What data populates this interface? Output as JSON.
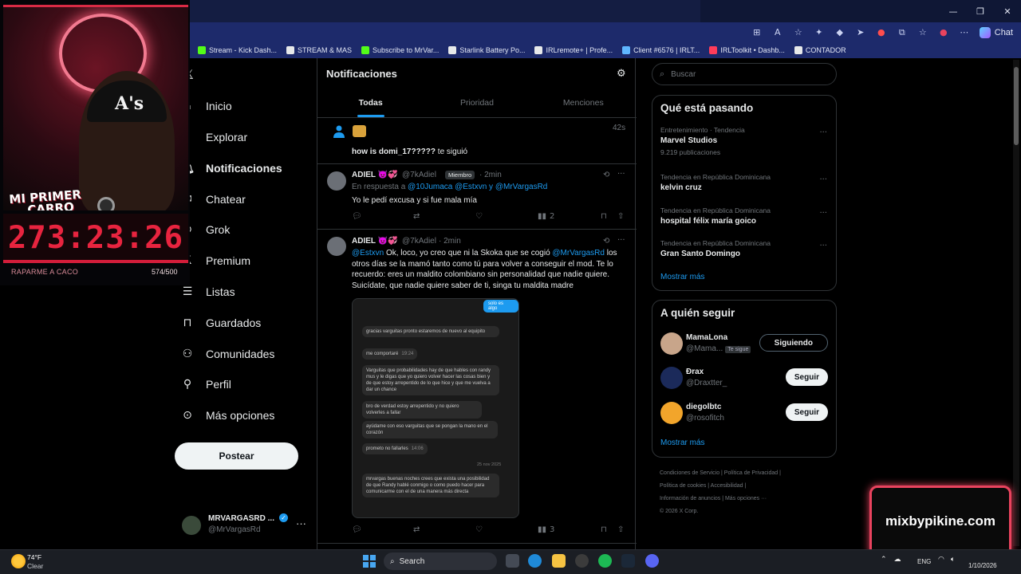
{
  "browser": {
    "chat_label": "Chat",
    "bookmarks": [
      {
        "label": "Stream - Kick Dash...",
        "color": "#53fc18"
      },
      {
        "label": "STREAM & MAS",
        "color": "#e7e9ea"
      },
      {
        "label": "Subscribe to MrVar...",
        "color": "#53fc18"
      },
      {
        "label": "Starlink Battery Po...",
        "color": "#e7e9ea"
      },
      {
        "label": "IRLremote+ | Profe...",
        "color": "#e7e9ea"
      },
      {
        "label": "Client #6576 | IRLT...",
        "color": "#5fb6ff"
      },
      {
        "label": "IRLToolkit • Dashb...",
        "color": "#ff3c5a"
      },
      {
        "label": "CONTADOR",
        "color": "#e7e9ea"
      }
    ]
  },
  "overlay": {
    "hat_text": "A's",
    "badge_line1": "MI PRIMER",
    "badge_line2": "CARRO",
    "timer": "273:23:26",
    "goal_label": "RAPARME A CACO",
    "goal_count": "574/500"
  },
  "nav": {
    "items": [
      {
        "label": "Inicio",
        "icon": "home-icon"
      },
      {
        "label": "Explorar",
        "icon": "search-icon"
      },
      {
        "label": "Notificaciones",
        "icon": "bell-icon"
      },
      {
        "label": "Chatear",
        "icon": "mail-icon"
      },
      {
        "label": "Grok",
        "icon": "grok-icon"
      },
      {
        "label": "Premium",
        "icon": "x-logo-icon"
      },
      {
        "label": "Listas",
        "icon": "list-icon"
      },
      {
        "label": "Guardados",
        "icon": "bookmark-icon"
      },
      {
        "label": "Comunidades",
        "icon": "people-icon"
      },
      {
        "label": "Perfil",
        "icon": "person-icon"
      },
      {
        "label": "Más opciones",
        "icon": "more-circle-icon"
      }
    ],
    "post_label": "Postear",
    "account": {
      "name": "MRVARGASRD ...",
      "handle": "@MrVargasRd"
    }
  },
  "main": {
    "title": "Notificaciones",
    "tabs": [
      "Todas",
      "Prioridad",
      "Menciones"
    ],
    "follow_notice": {
      "text": "how is domi_17?????",
      "suffix": " te siguió",
      "time": "42s"
    },
    "tweet1": {
      "name": "ADIEL",
      "emoji": "😈💞",
      "handle": "@7kAdiel",
      "badge": "Miembro",
      "time": "2min",
      "reply_prefix": "En respuesta a ",
      "reply_users": "@10Jumaca @Estxvn y @MrVargasRd",
      "text": "Yo le pedí excusa y si fue mala mía",
      "views": "2"
    },
    "tweet2": {
      "name": "ADIEL",
      "emoji": "😈💞",
      "handle": "@7kAdiel",
      "time": "2min",
      "mention1": "@Estxvn",
      "text_a": " Ok, loco, yo creo que ni la Skoka que se cogió ",
      "mention2": "@MrVargasRd",
      "text_b": " los otros días se la mamó tanto como tú para volver a conseguir el mod. Te lo recuerdo: eres un maldito colombiano sin personalidad que nadie quiere. Suicídate, que nadie quiere saber de ti, singa tu maldita madre",
      "views": "3"
    },
    "chat_image": {
      "top_label": "solo es algo",
      "bubbles": [
        {
          "text": "gracias varguitas pronto estaremos de nuevo al equipito",
          "time": ""
        },
        {
          "text": "me comportaré",
          "time": "19:24"
        },
        {
          "text": "Varguitas que probabilidades hay de que hables con randy mus y le digas que yo quiero volver hacer las cosas bien y de que estoy arrepentido de lo que hice y que me vuelva a dar un chance",
          "time": ""
        },
        {
          "text": "bro de verdad estoy arrepentido y no quiero volverles a fallar",
          "time": ""
        },
        {
          "text": "ayúdame con eso varguitas que se pongan la mano en el corazón",
          "time": ""
        },
        {
          "text": "prometo no fallarles",
          "time": "14:06"
        },
        {
          "text": "mrvargas buenas noches crees que exista una posibilidad de que Randy hablé conmigo o como puedo hacer para comunicarme con el de una manera más directa",
          "time": ""
        }
      ],
      "date_sep": "25 nov 2025"
    }
  },
  "right": {
    "search_placeholder": "Buscar",
    "trends_title": "Qué está pasando",
    "trends": [
      {
        "meta": "Entretenimiento · Tendencia",
        "title": "Marvel Studios",
        "count": "9.219 publicaciones"
      },
      {
        "meta": "Tendencia en República Dominicana",
        "title": "kelvin cruz",
        "count": ""
      },
      {
        "meta": "Tendencia en República Dominicana",
        "title": "hospital félix maría goico",
        "count": ""
      },
      {
        "meta": "Tendencia en República Dominicana",
        "title": "Gran Santo Domingo",
        "count": ""
      }
    ],
    "show_more": "Mostrar más",
    "follow_title": "A quién seguir",
    "who_to_follow": [
      {
        "name": "MamaLona",
        "handle": "@Mama...",
        "follows_you": "Te sigue",
        "button": "Siguiendo",
        "avatar": "#c8a58a"
      },
      {
        "name": "Ðrax",
        "handle": "@Draxtter_",
        "follows_you": "",
        "button": "Seguir",
        "avatar": "#1b2a5a"
      },
      {
        "name": "diegolbtc",
        "handle": "@rosofitch",
        "follows_you": "",
        "button": "Seguir",
        "avatar": "#f2a52b"
      }
    ],
    "footer_row1": "Condiciones de Servicio  |  Política de Privacidad  |",
    "footer_row2": "Política de cookies  |  Accesibilidad  |",
    "footer_row3": "Información de anuncios  |  Más opciones ···",
    "footer_row4": "© 2026 X Corp."
  },
  "watermark": "mixbypikine.com",
  "taskbar": {
    "temp": "74°F",
    "condition": "Clear",
    "search": "Search",
    "lang": "ENG",
    "date": "1/10/2026"
  }
}
